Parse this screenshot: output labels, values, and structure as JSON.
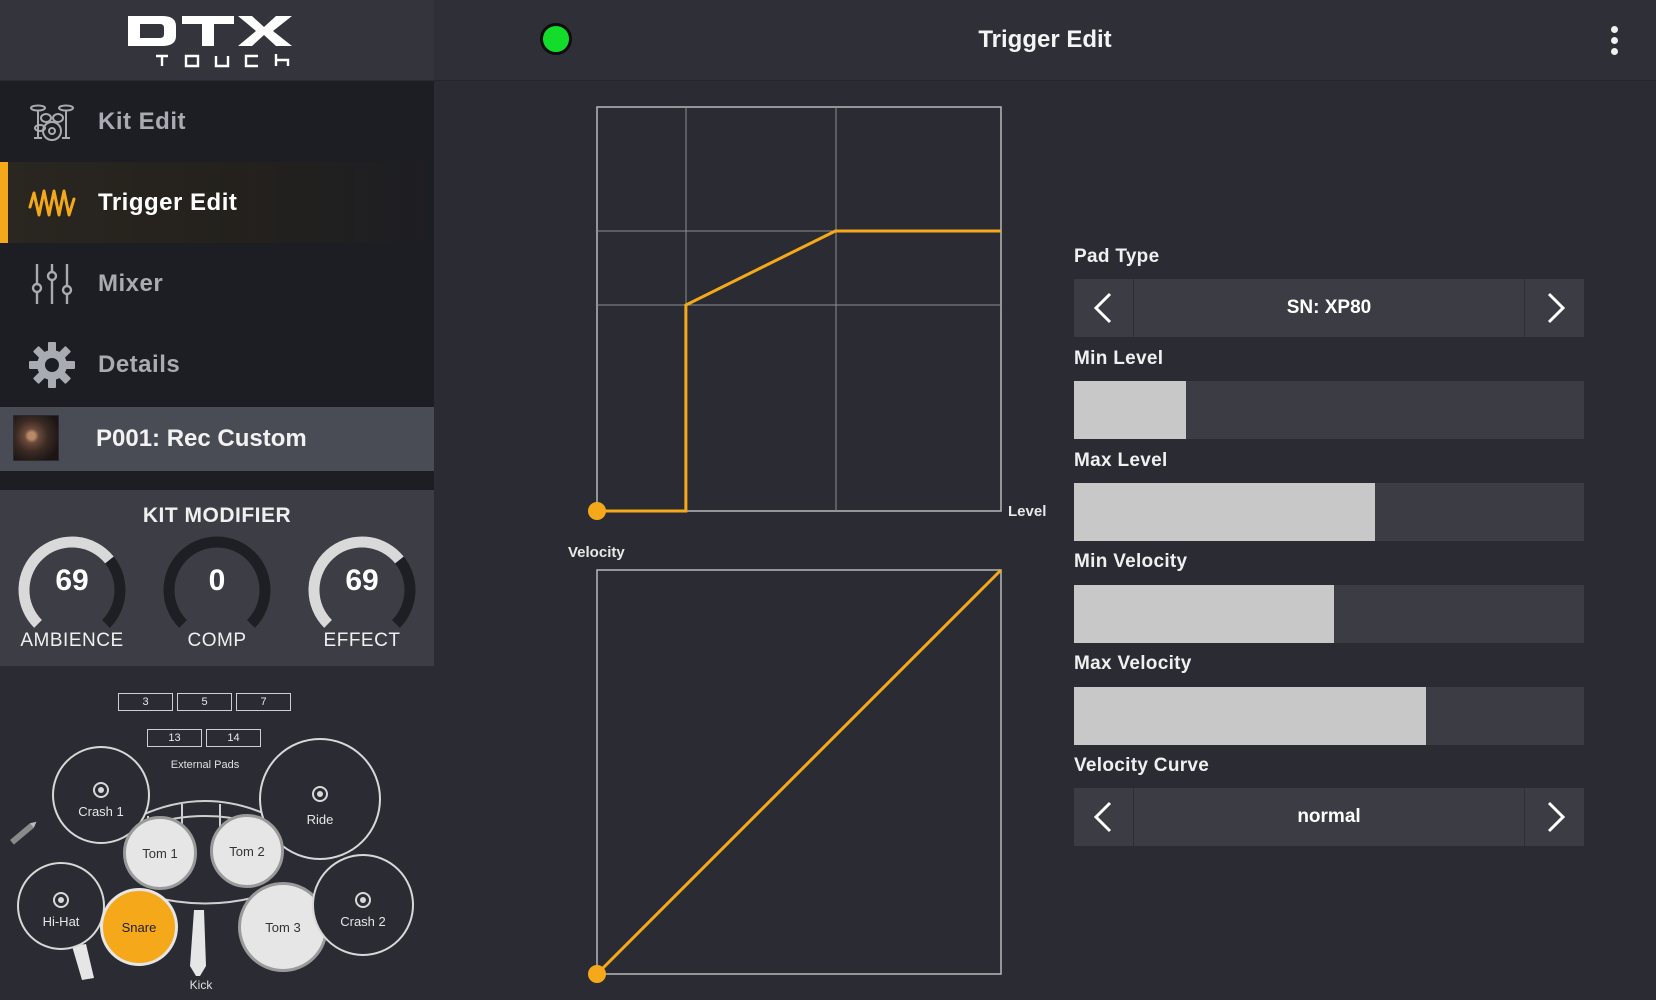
{
  "app": {
    "logo_text": "DTX",
    "logo_subtext": "TOUCH"
  },
  "sidebar": {
    "items": [
      {
        "label": "Kit Edit",
        "icon": "drum-kit-icon",
        "active": false
      },
      {
        "label": "Trigger Edit",
        "icon": "waveform-icon",
        "active": true
      },
      {
        "label": "Mixer",
        "icon": "mixer-sliders-icon",
        "active": false
      },
      {
        "label": "Details",
        "icon": "gear-icon",
        "active": false
      }
    ],
    "kit": {
      "name": "P001: Rec Custom"
    }
  },
  "kit_modifier": {
    "title": "KIT MODIFIER",
    "knobs": [
      {
        "label": "AMBIENCE",
        "value": "69",
        "fraction": 0.69
      },
      {
        "label": "COMP",
        "value": "0",
        "fraction": 0.0
      },
      {
        "label": "EFFECT",
        "value": "69",
        "fraction": 0.69
      }
    ]
  },
  "kit_map": {
    "external_pads_label": "External Pads",
    "external_pads_row1": [
      "3",
      "5",
      "7"
    ],
    "external_pads_row2": [
      "13",
      "14"
    ],
    "pads": {
      "crash1": "Crash 1",
      "ride": "Ride",
      "tom1": "Tom 1",
      "tom2": "Tom 2",
      "hihat": "Hi-Hat",
      "snare": "Snare",
      "tom3": "Tom 3",
      "crash2": "Crash 2",
      "kick": "Kick"
    },
    "selected_pad": "Snare"
  },
  "header": {
    "title": "Trigger Edit",
    "status_color": "#13dd2a"
  },
  "graphs": {
    "level_axis_label": "Level",
    "velocity_axis_label": "Velocity",
    "accent_color": "#f5a91a"
  },
  "controls": {
    "pad_type": {
      "label": "Pad Type",
      "value": "SN: XP80"
    },
    "min_level": {
      "label": "Min Level",
      "fraction": 0.22
    },
    "max_level": {
      "label": "Max Level",
      "fraction": 0.59
    },
    "min_velocity": {
      "label": "Min Velocity",
      "fraction": 0.51
    },
    "max_velocity": {
      "label": "Max Velocity",
      "fraction": 0.69
    },
    "velocity_curve": {
      "label": "Velocity Curve",
      "value": "normal"
    }
  }
}
